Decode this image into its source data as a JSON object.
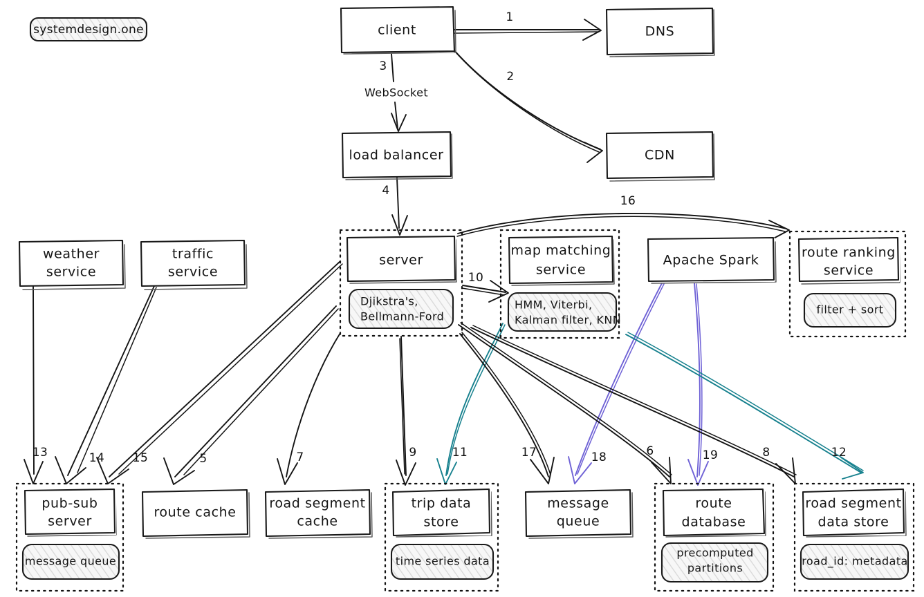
{
  "brand": {
    "badge_label": "systemdesign.one"
  },
  "palette": {
    "ink": "#141414",
    "teal": "#17818e",
    "purple": "#6f62d6",
    "hatch_fill": "#f4f4f4",
    "paper": "#ffffff"
  },
  "nodes": {
    "client": {
      "label": "client"
    },
    "dns": {
      "label": "DNS"
    },
    "cdn": {
      "label": "CDN"
    },
    "load_balancer": {
      "label": "load balancer"
    },
    "server": {
      "label": "server",
      "sub": "Djikstra's,\nBellmann-Ford",
      "sub_line1": "Djikstra's,",
      "sub_line2": "Bellmann-Ford"
    },
    "map_matching_service": {
      "label": "map matching\nservice",
      "label_line1": "map matching",
      "label_line2": "service",
      "sub_line1": "HMM, Viterbi,",
      "sub_line2": "Kalman filter, KNN"
    },
    "apache_spark": {
      "label": "Apache Spark"
    },
    "route_ranking_service": {
      "label": "route ranking\nservice",
      "label_line1": "route ranking",
      "label_line2": "service",
      "sub": "filter + sort"
    },
    "weather_service": {
      "label": "weather\nservice",
      "label_line1": "weather",
      "label_line2": "service"
    },
    "traffic_service": {
      "label": "traffic\nservice",
      "label_line1": "traffic",
      "label_line2": "service"
    },
    "pubsub_server": {
      "label": "pub-sub\nserver",
      "label_line1": "pub-sub",
      "label_line2": "server",
      "sub": "message queue"
    },
    "route_cache": {
      "label": "route cache"
    },
    "road_segment_cache": {
      "label": "road segment\ncache",
      "label_line1": "road segment",
      "label_line2": "cache"
    },
    "trip_data_store": {
      "label": "trip data\nstore",
      "label_line1": "trip data",
      "label_line2": "store",
      "sub": "time series data"
    },
    "message_queue": {
      "label": "message\nqueue",
      "label_line1": "message",
      "label_line2": "queue"
    },
    "route_database": {
      "label": "route\ndatabase",
      "label_line1": "route",
      "label_line2": "database",
      "sub_line1": "precomputed",
      "sub_line2": "partitions"
    },
    "road_segment_data_store": {
      "label": "road segment\ndata store",
      "label_line1": "road segment",
      "label_line2": "data store",
      "sub": "road_id: metadata"
    }
  },
  "edges": [
    {
      "id": "e1",
      "num": "1",
      "from": "client",
      "to": "dns",
      "color": "#141414"
    },
    {
      "id": "e2",
      "num": "2",
      "from": "client",
      "to": "cdn",
      "color": "#141414"
    },
    {
      "id": "e3",
      "num": "3",
      "from": "client",
      "to": "load_balancer",
      "color": "#141414",
      "note": "WebSocket"
    },
    {
      "id": "e4",
      "num": "4",
      "from": "load_balancer",
      "to": "server",
      "color": "#141414"
    },
    {
      "id": "e5",
      "num": "5",
      "from": "server",
      "to": "route_cache",
      "color": "#141414"
    },
    {
      "id": "e6",
      "num": "6",
      "from": "server",
      "to": "route_database",
      "color": "#141414"
    },
    {
      "id": "e7",
      "num": "7",
      "from": "server",
      "to": "road_segment_cache",
      "color": "#141414"
    },
    {
      "id": "e8",
      "num": "8",
      "from": "server",
      "to": "road_segment_data_store",
      "color": "#141414"
    },
    {
      "id": "e9",
      "num": "9",
      "from": "server",
      "to": "trip_data_store",
      "color": "#141414"
    },
    {
      "id": "e10",
      "num": "10",
      "from": "server",
      "to": "map_matching_service",
      "color": "#141414"
    },
    {
      "id": "e11",
      "num": "11",
      "from": "map_matching_service",
      "to": "trip_data_store",
      "color": "#17818e"
    },
    {
      "id": "e12",
      "num": "12",
      "from": "map_matching_service",
      "to": "road_segment_data_store",
      "color": "#17818e"
    },
    {
      "id": "e13",
      "num": "13",
      "from": "weather_service",
      "to": "pubsub_server",
      "color": "#141414"
    },
    {
      "id": "e14",
      "num": "14",
      "from": "traffic_service",
      "to": "pubsub_server",
      "color": "#141414"
    },
    {
      "id": "e15",
      "num": "15",
      "from": "server",
      "to": "pubsub_server",
      "color": "#141414"
    },
    {
      "id": "e16",
      "num": "16",
      "from": "server",
      "to": "route_ranking_service",
      "color": "#141414"
    },
    {
      "id": "e17",
      "num": "17",
      "from": "server",
      "to": "message_queue",
      "color": "#141414"
    },
    {
      "id": "e18",
      "num": "18",
      "from": "apache_spark",
      "to": "message_queue",
      "color": "#6f62d6"
    },
    {
      "id": "e19",
      "num": "19",
      "from": "apache_spark",
      "to": "route_database",
      "color": "#6f62d6"
    }
  ]
}
